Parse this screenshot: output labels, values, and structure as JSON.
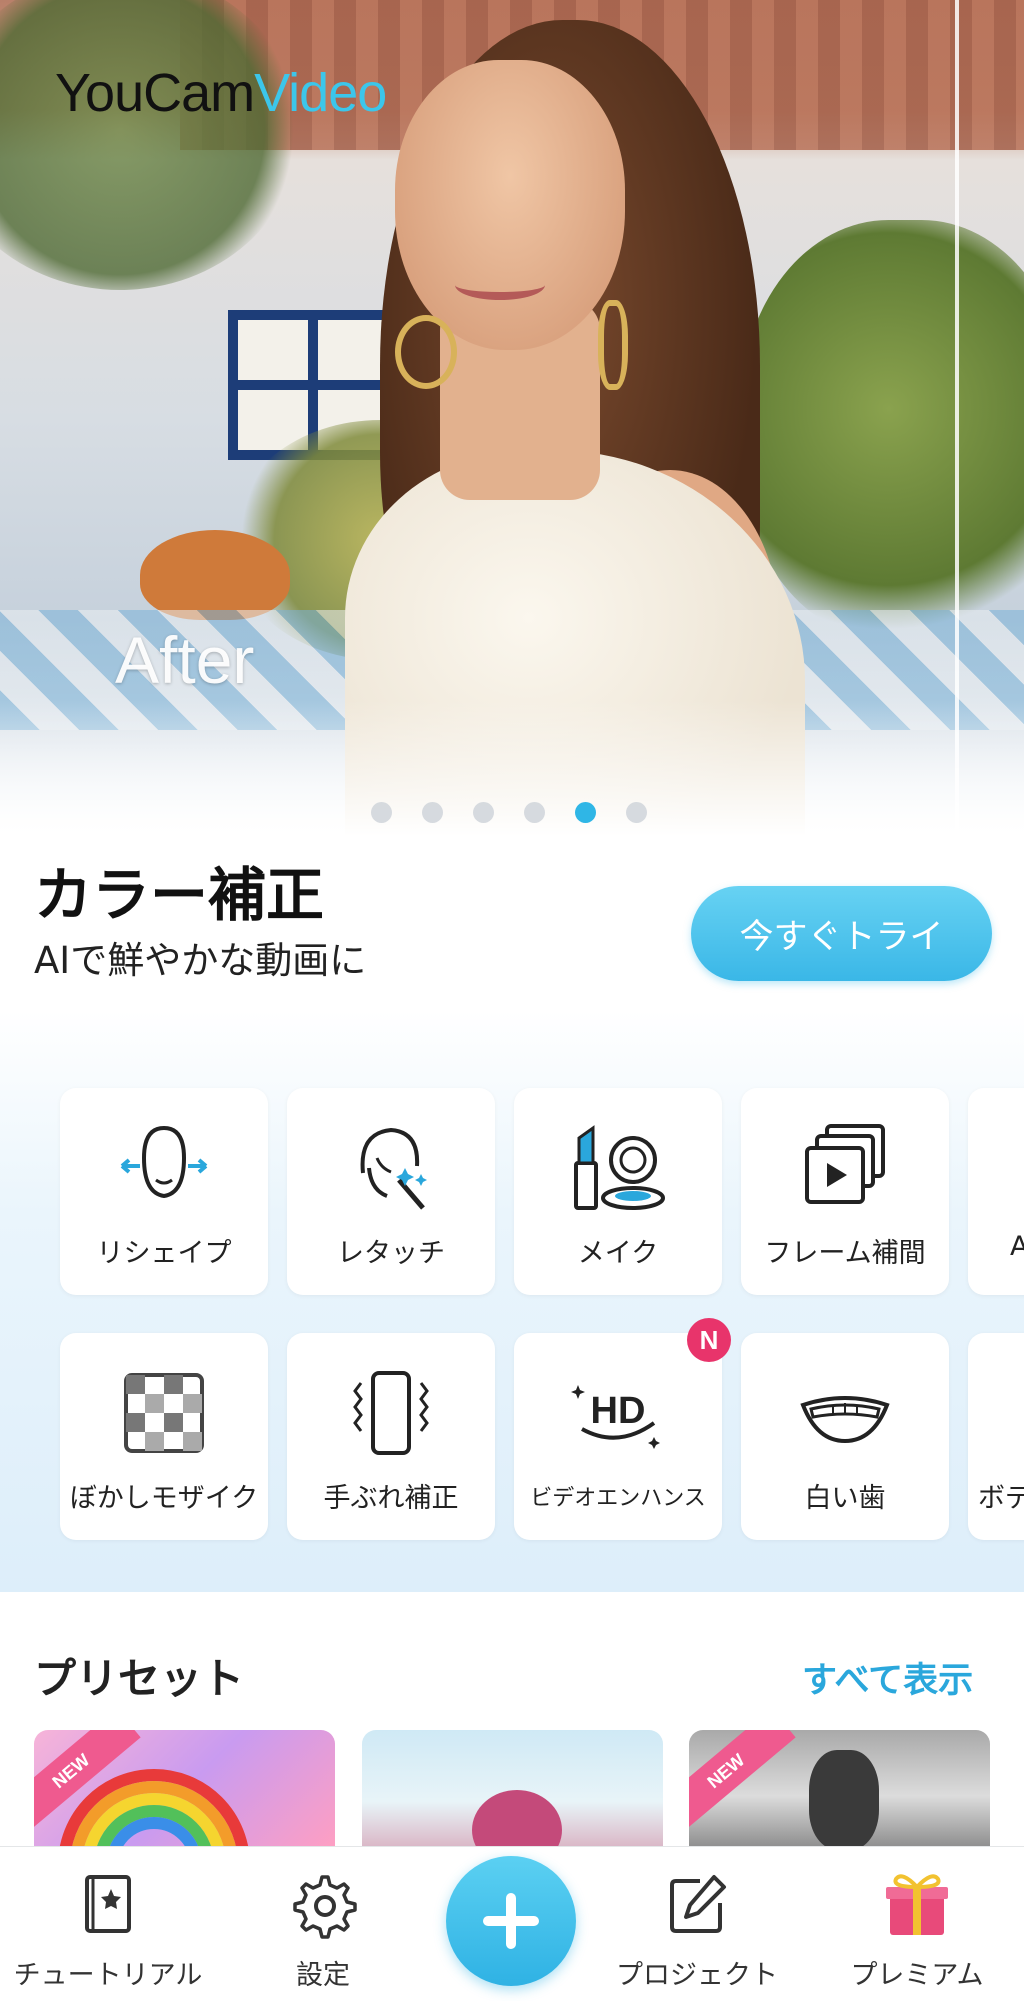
{
  "hero": {
    "logo_part1": "YouCam",
    "logo_part2": "Video",
    "overlay_label": "After",
    "carousel_dots": 6,
    "active_dot": 5
  },
  "feature": {
    "title": "カラー補正",
    "subtitle": "AIで鮮やかな動画に",
    "try_button": "今すぐトライ"
  },
  "tools": {
    "row1": [
      {
        "label": "リシェイプ",
        "icon": "face-reshape-icon"
      },
      {
        "label": "レタッチ",
        "icon": "retouch-wand-icon"
      },
      {
        "label": "メイク",
        "icon": "lipstick-compact-icon"
      },
      {
        "label": "フレーム補間",
        "icon": "frame-stack-play-icon"
      },
      {
        "label": "A",
        "icon": "partial-tile"
      }
    ],
    "row2": [
      {
        "label": "ぼかしモザイク",
        "icon": "mosaic-checker-icon"
      },
      {
        "label": "手ぶれ補正",
        "icon": "phone-stabilize-icon"
      },
      {
        "label": "ビデオエンハンス",
        "icon": "hd-enhance-icon",
        "badge": "N"
      },
      {
        "label": "白い歯",
        "icon": "teeth-smile-icon"
      },
      {
        "label": "ボデ",
        "icon": "partial-tile"
      }
    ]
  },
  "presets": {
    "title": "プリセット",
    "see_all": "すべて表示",
    "items": [
      {
        "ribbon": "NEW"
      },
      {
        "ribbon": ""
      },
      {
        "ribbon": "NEW"
      }
    ]
  },
  "bottom_nav": {
    "tutorial": "チュートリアル",
    "settings": "設定",
    "add": "+",
    "project": "プロジェクト",
    "premium": "プレミアム"
  },
  "colors": {
    "accent": "#3ab7e7",
    "badge": "#e8346b",
    "ribbon": "#ef5a8f",
    "gift_box": "#e84a7a",
    "gift_ribbon": "#f2c230"
  }
}
